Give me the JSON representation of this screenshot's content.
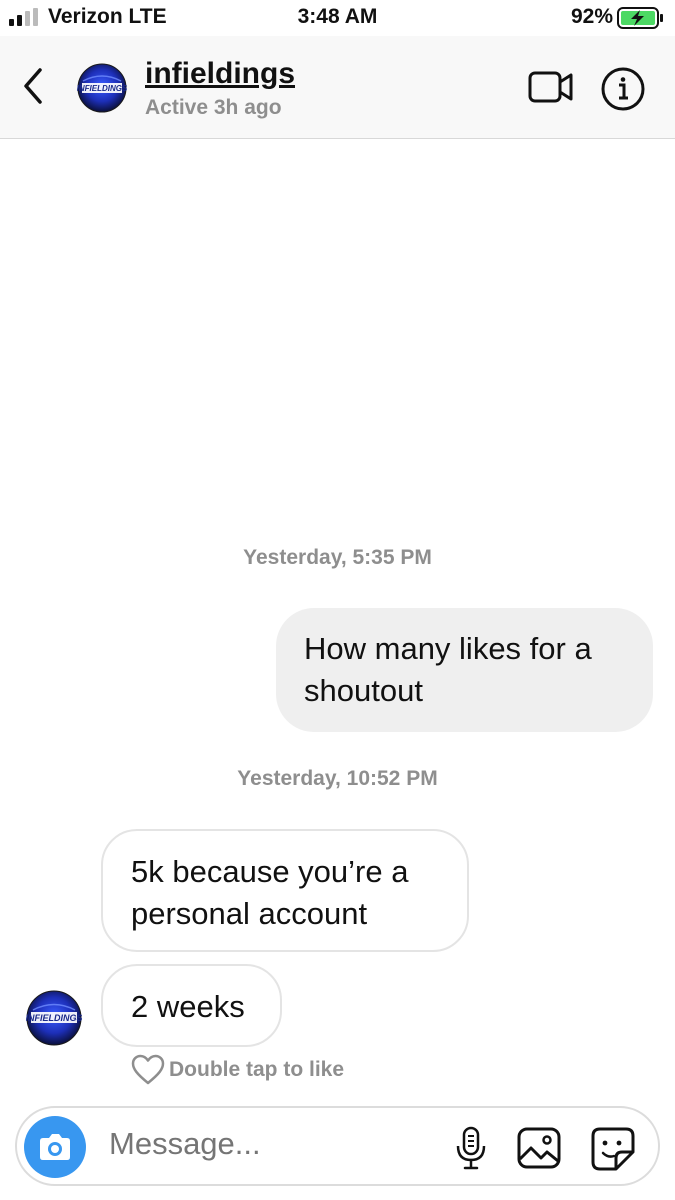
{
  "status_bar": {
    "carrier": "Verizon LTE",
    "time": "3:48 AM",
    "battery": "92%",
    "battery_color": "#4cd964"
  },
  "header": {
    "username": "infieldings",
    "status": "Active 3h ago",
    "avatar_text": "INFIELDINGS"
  },
  "thread": {
    "timestamp_1": "Yesterday, 5:35 PM",
    "sent_message": "How many likes for a shoutout",
    "timestamp_2": "Yesterday, 10:52 PM",
    "received_1": "5k because you’re a personal account",
    "received_2": "2 weeks",
    "like_hint": "Double tap to like"
  },
  "composer": {
    "placeholder": "Message..."
  },
  "colors": {
    "accent": "#3897f0",
    "muted": "#8e8e8e",
    "bubble_out": "#efefef",
    "bubble_in_border": "#e4e4e4"
  }
}
